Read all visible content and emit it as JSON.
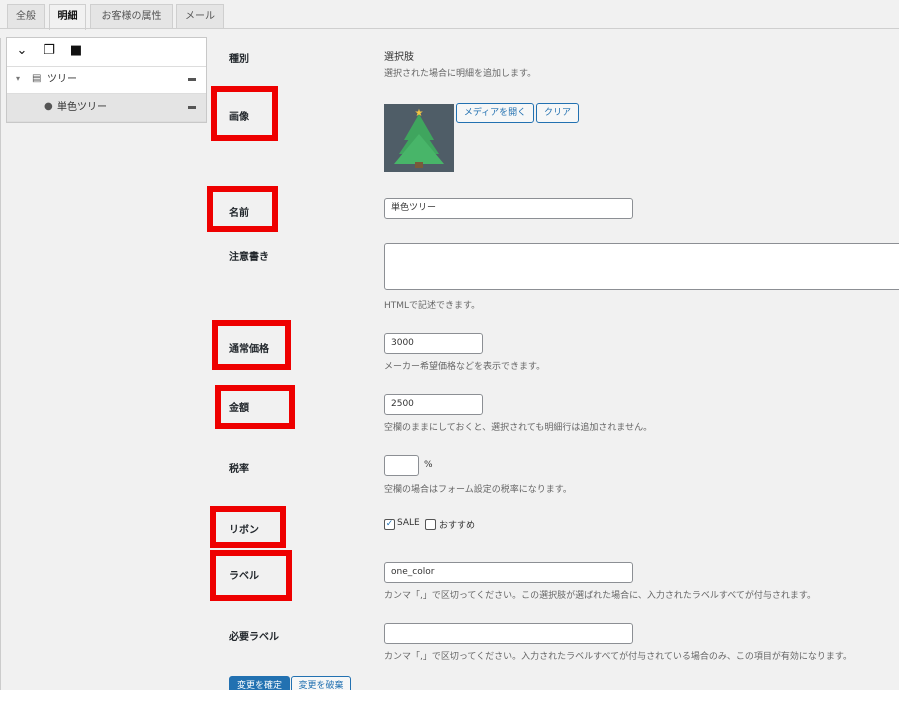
{
  "tabs": [
    "全般",
    "明細",
    "お客様の属性",
    "メール"
  ],
  "active_tab": 1,
  "tree": {
    "toolbar_icons": [
      "chevron-down-icon",
      "copy-icon",
      "trash-icon"
    ],
    "items": [
      {
        "label": "ツリー",
        "icon": "list-icon"
      },
      {
        "label": "単色ツリー",
        "icon": "check-circle-icon"
      }
    ]
  },
  "form": {
    "type": {
      "label": "種別",
      "value": "選択肢",
      "desc": "選択された場合に明細を追加します。"
    },
    "image": {
      "label": "画像",
      "open_media": "メディアを開く",
      "clear": "クリア"
    },
    "name": {
      "label": "名前",
      "value": "単色ツリー"
    },
    "note": {
      "label": "注意書き",
      "value": "",
      "desc": "HTMLで記述できます。"
    },
    "regular_price": {
      "label": "通常価格",
      "value": "3000",
      "desc": "メーカー希望価格などを表示できます。"
    },
    "amount": {
      "label": "金額",
      "value": "2500",
      "desc": "空欄のままにしておくと、選択されても明細行は追加されません。"
    },
    "tax": {
      "label": "税率",
      "value": "",
      "unit": "%",
      "desc": "空欄の場合はフォーム設定の税率になります。"
    },
    "ribbon": {
      "label": "リボン",
      "options": [
        {
          "label": "SALE",
          "checked": true
        },
        {
          "label": "おすすめ",
          "checked": false
        }
      ]
    },
    "tag": {
      "label": "ラベル",
      "value": "one_color",
      "desc": "カンマ「,」で区切ってください。この選択肢が選ばれた場合に、入力されたラベルすべてが付与されます。"
    },
    "required_tag": {
      "label": "必要ラベル",
      "value": "",
      "desc": "カンマ「,」で区切ってください。入力されたラベルすべてが付与されている場合のみ、この項目が有効になります。"
    },
    "apply_button": "変更を確定",
    "cancel_button": "変更を破棄"
  },
  "colors": {
    "highlight": "#ee0000",
    "accent": "#2271b1"
  }
}
